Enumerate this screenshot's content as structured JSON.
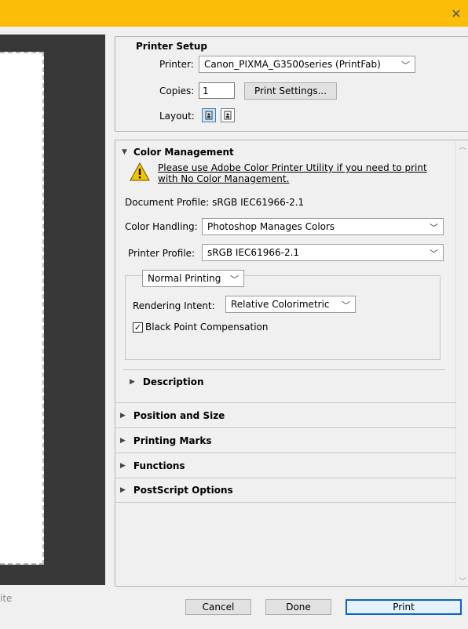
{
  "window": {
    "close_glyph": "✕",
    "accent": "#fbbd08"
  },
  "preview": {
    "footer_text": "ite"
  },
  "printer_setup": {
    "title": "Printer Setup",
    "printer_label": "Printer:",
    "printer_value": "Canon_PIXMA_G3500series (PrintFab)",
    "copies_label": "Copies:",
    "copies_value": "1",
    "print_settings_label": "Print Settings...",
    "layout_label": "Layout:"
  },
  "color_management": {
    "title": "Color Management",
    "warning_line1": "Please use Adobe Color Printer Utility if you need to print",
    "warning_line2": "with No Color Management.",
    "document_profile": "Document Profile: sRGB IEC61966-2.1",
    "color_handling_label": "Color Handling:",
    "color_handling_value": "Photoshop Manages Colors",
    "printer_profile_label": "Printer Profile:",
    "printer_profile_value": "sRGB IEC61966-2.1",
    "printing_mode_value": "Normal Printing",
    "rendering_intent_label": "Rendering Intent:",
    "rendering_intent_value": "Relative Colorimetric",
    "black_point_label": "Black Point Compensation",
    "black_point_checked": true,
    "description_label": "Description"
  },
  "sections": [
    {
      "label": "Position and Size"
    },
    {
      "label": "Printing Marks"
    },
    {
      "label": "Functions"
    },
    {
      "label": "PostScript Options"
    }
  ],
  "buttons": {
    "cancel": "Cancel",
    "done": "Done",
    "print": "Print"
  }
}
